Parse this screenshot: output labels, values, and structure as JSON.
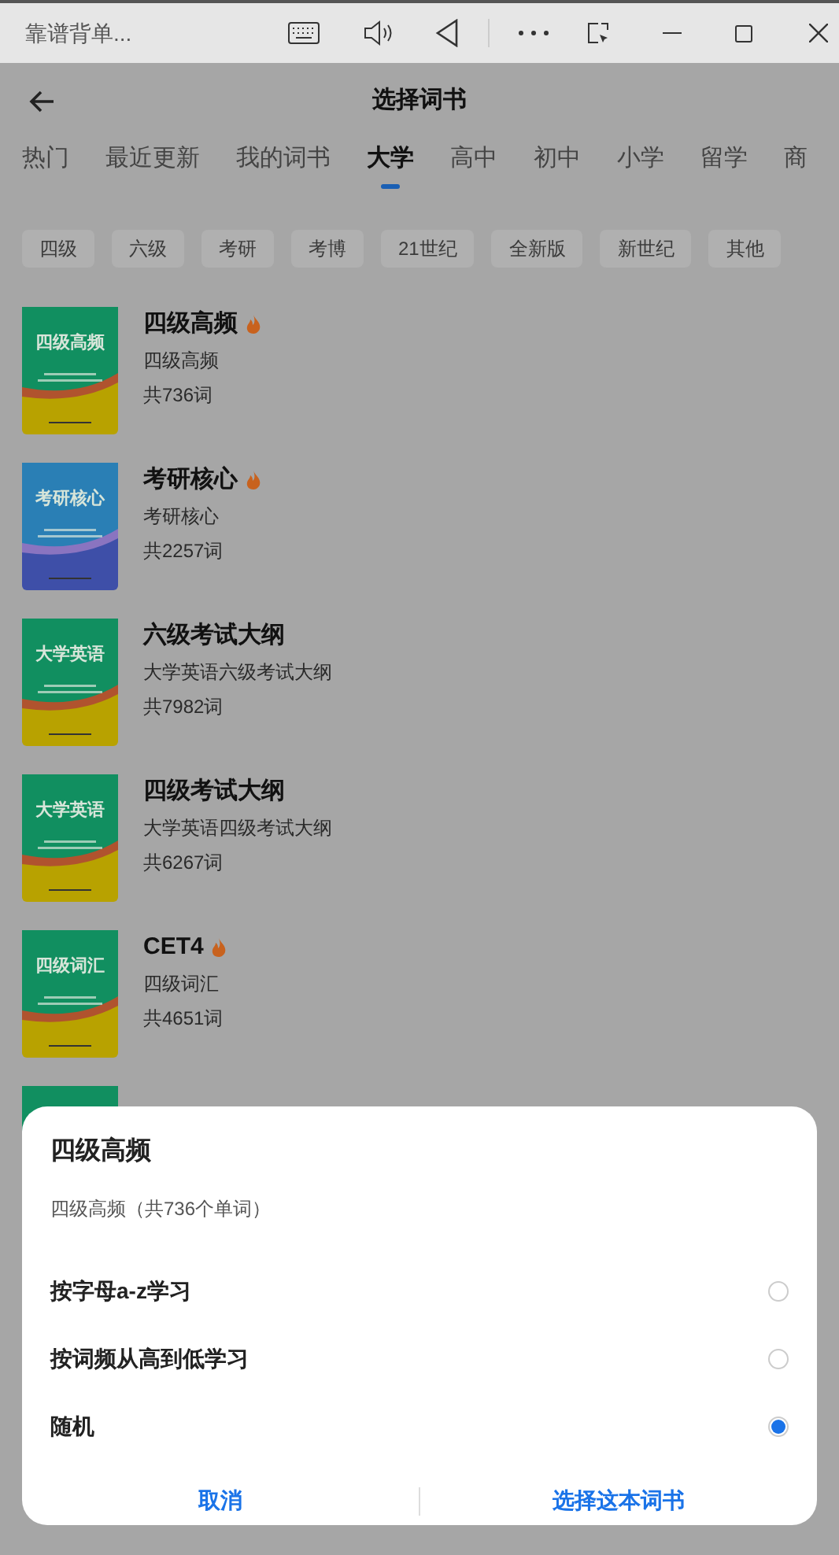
{
  "title_bar": {
    "title": "靠谱背单..."
  },
  "header": {
    "title": "选择词书"
  },
  "tabs": [
    {
      "label": "热门",
      "selected": false
    },
    {
      "label": "最近更新",
      "selected": false
    },
    {
      "label": "我的词书",
      "selected": false
    },
    {
      "label": "大学",
      "selected": true
    },
    {
      "label": "高中",
      "selected": false
    },
    {
      "label": "初中",
      "selected": false
    },
    {
      "label": "小学",
      "selected": false
    },
    {
      "label": "留学",
      "selected": false
    },
    {
      "label": "商",
      "selected": false
    }
  ],
  "filters": [
    "四级",
    "六级",
    "考研",
    "考博",
    "21世纪",
    "全新版",
    "新世纪",
    "其他"
  ],
  "books": [
    {
      "name": "四级高频",
      "hot": true,
      "description": "四级高频",
      "count": "共736词",
      "cover_title": "四级高频",
      "kind": "green"
    },
    {
      "name": "考研核心",
      "hot": true,
      "description": "考研核心",
      "count": "共2257词",
      "cover_title": "考研核心",
      "kind": "blue"
    },
    {
      "name": "六级考试大纲",
      "hot": false,
      "description": "大学英语六级考试大纲",
      "count": "共7982词",
      "cover_title": "大学英语",
      "kind": "green"
    },
    {
      "name": "四级考试大纲",
      "hot": false,
      "description": "大学英语四级考试大纲",
      "count": "共6267词",
      "cover_title": "大学英语",
      "kind": "green"
    },
    {
      "name": "CET4",
      "hot": true,
      "description": "四级词汇",
      "count": "共4651词",
      "cover_title": "四级词汇",
      "kind": "green"
    },
    {
      "kind": "green"
    }
  ],
  "dialog": {
    "title": "四级高频",
    "subtitle": "四级高频（共736个单词）",
    "options": [
      {
        "label": "按字母a-z学习",
        "selected": false
      },
      {
        "label": "按词频从高到低学习",
        "selected": false
      },
      {
        "label": "随机",
        "selected": true
      }
    ],
    "cancel": "取消",
    "confirm": "选择这本词书"
  }
}
